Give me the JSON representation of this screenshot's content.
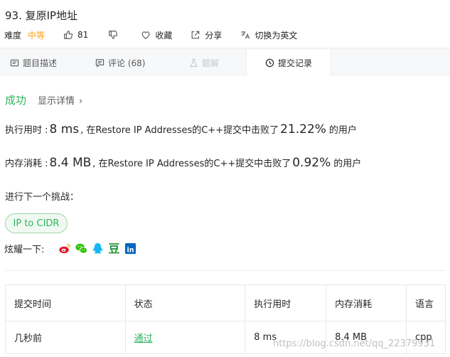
{
  "problem": {
    "title": "93. 复原IP地址",
    "difficulty_label": "难度",
    "difficulty_value": "中等",
    "likes": "81",
    "favorite_label": "收藏",
    "share_label": "分享",
    "switch_lang_label": "切换为英文"
  },
  "tabs": [
    {
      "label": "题目描述"
    },
    {
      "label": "评论 (68)"
    },
    {
      "label": "题解"
    },
    {
      "label": "提交记录"
    }
  ],
  "result": {
    "status": "成功",
    "details_label": "显示详情",
    "runtime_prefix": "执行用时 :",
    "runtime_value": "8 ms",
    "runtime_mid": ", 在Restore IP Addresses的C++提交中击败了",
    "runtime_percent": "21.22%",
    "runtime_suffix": "的用户",
    "memory_prefix": "内存消耗 :",
    "memory_value": "8.4 MB",
    "memory_mid": ", 在Restore IP Addresses的C++提交中击败了",
    "memory_percent": "0.92%",
    "memory_suffix": "的用户"
  },
  "challenge": {
    "label": "进行下一个挑战：",
    "next_problem": "IP to CIDR"
  },
  "share": {
    "label": "炫耀一下:",
    "douban_glyph": "豆",
    "linkedin_glyph": "in"
  },
  "table": {
    "headers": [
      "提交时间",
      "状态",
      "执行用时",
      "内存消耗",
      "语言"
    ],
    "rows": [
      {
        "time": "几秒前",
        "status": "通过",
        "runtime": "8 ms",
        "memory": "8.4 MB",
        "language": "cpp"
      }
    ]
  },
  "watermark": "https://blog.csdn.net/qq_22379931",
  "colors": {
    "accent_green": "#2db55d",
    "medium_orange": "#ffa116",
    "weibo_red": "#e6162d",
    "wechat_green": "#2dc100",
    "qq_blue": "#12b7f5",
    "douban_green": "#2e963d",
    "linkedin_blue": "#0a66c2"
  }
}
